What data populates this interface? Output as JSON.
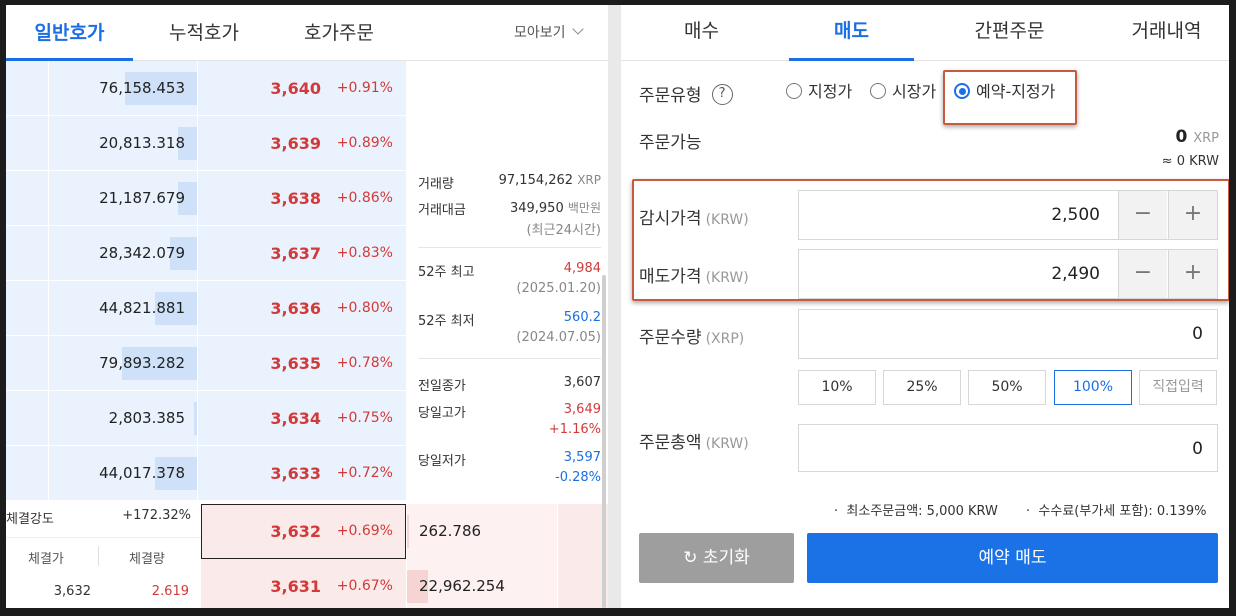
{
  "left_tabs": [
    "일반호가",
    "누적호가",
    "호가주문"
  ],
  "view_toggle": "모아보기",
  "asks": [
    {
      "qty": "76,158.453",
      "price": "3,640",
      "pct": "+0.91%",
      "depth": 0.48
    },
    {
      "qty": "20,813.318",
      "price": "3,639",
      "pct": "+0.89%",
      "depth": 0.13
    },
    {
      "qty": "21,187.679",
      "price": "3,638",
      "pct": "+0.86%",
      "depth": 0.13
    },
    {
      "qty": "28,342.079",
      "price": "3,637",
      "pct": "+0.83%",
      "depth": 0.18
    },
    {
      "qty": "44,821.881",
      "price": "3,636",
      "pct": "+0.80%",
      "depth": 0.28
    },
    {
      "qty": "79,893.282",
      "price": "3,635",
      "pct": "+0.78%",
      "depth": 0.5
    },
    {
      "qty": "2,803.385",
      "price": "3,634",
      "pct": "+0.75%",
      "depth": 0.02
    },
    {
      "qty": "44,017.378",
      "price": "3,633",
      "pct": "+0.72%",
      "depth": 0.28
    }
  ],
  "bids": [
    {
      "qty": "262.786",
      "price": "3,632",
      "pct": "+0.69%",
      "depth": 0.01
    },
    {
      "qty": "22,962.254",
      "price": "3,631",
      "pct": "+0.67%",
      "depth": 0.14
    }
  ],
  "stats": {
    "volume_label": "거래량",
    "volume": "97,154,262",
    "volume_unit": "XRP",
    "amount_label": "거래대금",
    "amount": "349,950",
    "amount_unit": "백만원",
    "amount_note": "(최근24시간)",
    "high52_label": "52주 최고",
    "high52": "4,984",
    "high52_date": "(2025.01.20)",
    "low52_label": "52주 최저",
    "low52": "560.2",
    "low52_date": "(2024.07.05)",
    "prev_close_label": "전일종가",
    "prev_close": "3,607",
    "day_high_label": "당일고가",
    "day_high": "3,649",
    "day_high_pct": "+1.16%",
    "day_low_label": "당일저가",
    "day_low": "3,597",
    "day_low_pct": "-0.28%"
  },
  "trade": {
    "strength_label": "체결강도",
    "strength": "+172.32%",
    "price_header": "체결가",
    "qty_header": "체결량",
    "last_price": "3,632",
    "last_qty": "2.619"
  },
  "right_tabs": [
    "매수",
    "매도",
    "간편주문",
    "거래내역"
  ],
  "order": {
    "type_label": "주문유형",
    "help_icon": "?",
    "options": [
      "지정가",
      "시장가",
      "예약-지정가"
    ],
    "selected": "예약-지정가",
    "available_label": "주문가능",
    "available_value": "0",
    "available_unit": "XRP",
    "available_krw": "≈ 0 KRW",
    "watch_price_label": "감시가격",
    "watch_price_unit": "(KRW)",
    "watch_price": "2,500",
    "sell_price_label": "매도가격",
    "sell_price_unit": "(KRW)",
    "sell_price": "2,490",
    "qty_label": "주문수량",
    "qty_unit": "(XRP)",
    "qty": "0",
    "pct_buttons": [
      "10%",
      "25%",
      "50%",
      "100%",
      "직접입력"
    ],
    "total_label": "주문총액",
    "total_unit": "(KRW)",
    "total": "0",
    "min_note": "최소주문금액: 5,000 KRW",
    "fee_note": "수수료(부가세 포함): 0.139%",
    "reset_label": "초기화",
    "reset_icon_glyph": "↻",
    "submit_label": "예약 매도",
    "minus": "−",
    "plus": "+"
  },
  "colors": {
    "accent": "#1b6fe4",
    "up": "#d23a3a",
    "down": "#1b6fe4",
    "highlight": "#c85a3f"
  }
}
